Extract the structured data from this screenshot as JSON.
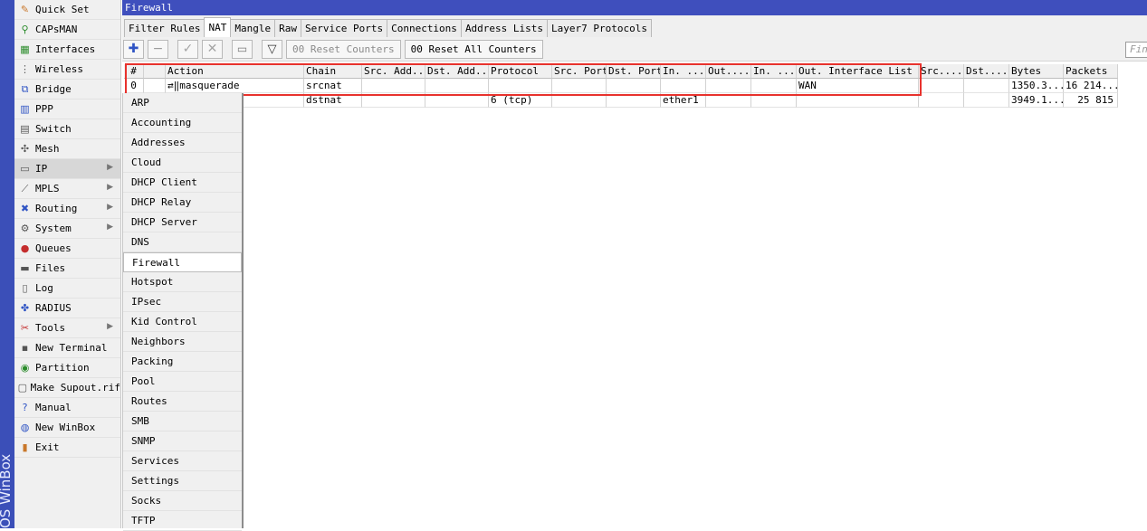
{
  "brand": {
    "text": "OS WinBox"
  },
  "main_menu": [
    {
      "label": "Quick Set",
      "icon": "quick-set-icon",
      "glyph": "✎",
      "color": "icn-orange"
    },
    {
      "label": "CAPsMAN",
      "icon": "antenna-icon",
      "glyph": "⚲",
      "color": "icn-green"
    },
    {
      "label": "Interfaces",
      "icon": "interfaces-icon",
      "glyph": "▦",
      "color": "icn-green"
    },
    {
      "label": "Wireless",
      "icon": "wireless-icon",
      "glyph": "⋮",
      "color": "icn-gray"
    },
    {
      "label": "Bridge",
      "icon": "bridge-icon",
      "glyph": "⧉",
      "color": "icn-blue"
    },
    {
      "label": "PPP",
      "icon": "ppp-icon",
      "glyph": "▥",
      "color": "icn-blue"
    },
    {
      "label": "Switch",
      "icon": "switch-icon",
      "glyph": "▤",
      "color": "icn-gray"
    },
    {
      "label": "Mesh",
      "icon": "mesh-icon",
      "glyph": "✣",
      "color": "icn-gray"
    },
    {
      "label": "IP",
      "icon": "ip-icon",
      "glyph": "▭",
      "color": "icn-gray",
      "submenu": true,
      "active": true
    },
    {
      "label": "MPLS",
      "icon": "mpls-icon",
      "glyph": "⟋",
      "color": "icn-gray",
      "submenu": true
    },
    {
      "label": "Routing",
      "icon": "routing-icon",
      "glyph": "✖",
      "color": "icn-blue",
      "submenu": true
    },
    {
      "label": "System",
      "icon": "system-icon",
      "glyph": "⚙",
      "color": "icn-gray",
      "submenu": true
    },
    {
      "label": "Queues",
      "icon": "queues-icon",
      "glyph": "●",
      "color": "icn-red"
    },
    {
      "label": "Files",
      "icon": "files-icon",
      "glyph": "▬",
      "color": "icn-gray"
    },
    {
      "label": "Log",
      "icon": "log-icon",
      "glyph": "▯",
      "color": "icn-gray"
    },
    {
      "label": "RADIUS",
      "icon": "radius-icon",
      "glyph": "✤",
      "color": "icn-blue"
    },
    {
      "label": "Tools",
      "icon": "tools-icon",
      "glyph": "✂",
      "color": "icn-red",
      "submenu": true
    },
    {
      "label": "New Terminal",
      "icon": "terminal-icon",
      "glyph": "▪",
      "color": "icn-gray"
    },
    {
      "label": "Partition",
      "icon": "partition-icon",
      "glyph": "◉",
      "color": "icn-green"
    },
    {
      "label": "Make Supout.rif",
      "icon": "supout-icon",
      "glyph": "▢",
      "color": "icn-gray"
    },
    {
      "label": "Manual",
      "icon": "manual-icon",
      "glyph": "?",
      "color": "icn-blue"
    },
    {
      "label": "New WinBox",
      "icon": "winbox-icon",
      "glyph": "◍",
      "color": "icn-blue"
    },
    {
      "label": "Exit",
      "icon": "exit-icon",
      "glyph": "▮",
      "color": "icn-orange"
    }
  ],
  "window": {
    "title": "Firewall",
    "tabs": [
      "Filter Rules",
      "NAT",
      "Mangle",
      "Raw",
      "Service Ports",
      "Connections",
      "Address Lists",
      "Layer7 Protocols"
    ],
    "active_tab": 1,
    "toolbar": {
      "reset_counters": "00 Reset Counters",
      "reset_all_counters": "00 Reset All Counters",
      "find_placeholder": "Find"
    }
  },
  "table": {
    "columns": [
      "#",
      "",
      "Action",
      "Chain",
      "Src. Add...",
      "Dst. Add...",
      "Protocol",
      "Src. Port",
      "Dst. Port",
      "In. ...",
      "Out....",
      "In. ...",
      "Out. Interface List",
      "Src....",
      "Dst....",
      "Bytes",
      "Packets"
    ],
    "rows": [
      [
        "0",
        "",
        "⇄‖masquerade",
        "srcnat",
        "",
        "",
        "",
        "",
        "",
        "",
        "",
        "",
        "WAN",
        "",
        "",
        "1350.3...",
        "16 214..."
      ],
      [
        "",
        "",
        "",
        "dstnat",
        "",
        "",
        "6 (tcp)",
        "",
        "",
        "ether1",
        "",
        "",
        "",
        "",
        "",
        "3949.1...",
        "25 815"
      ]
    ]
  },
  "ip_submenu": [
    "ARP",
    "Accounting",
    "Addresses",
    "Cloud",
    "DHCP Client",
    "DHCP Relay",
    "DHCP Server",
    "DNS",
    "Firewall",
    "Hotspot",
    "IPsec",
    "Kid Control",
    "Neighbors",
    "Packing",
    "Pool",
    "Routes",
    "SMB",
    "SNMP",
    "Services",
    "Settings",
    "Socks",
    "TFTP"
  ],
  "ip_submenu_active": "Firewall"
}
